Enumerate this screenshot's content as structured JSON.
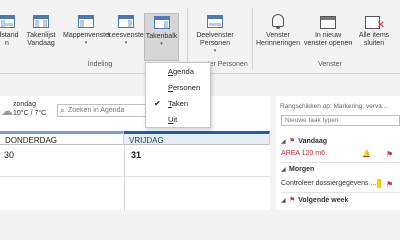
{
  "ribbon": {
    "buttons": {
      "mapvenster": {
        "line1": "Mappenvenster",
        "icon": "folder-pane-icon"
      },
      "leesvenster": {
        "line1": "Leesvenster",
        "icon": "reading-pane-icon"
      },
      "takenbalk": {
        "line1": "Takenbalk",
        "icon": "todo-bar-icon"
      },
      "deelvenster": {
        "line1": "Deelvenster",
        "line2": "Personen",
        "icon": "people-pane-icon"
      },
      "herinneringen": {
        "line1": "Venster",
        "line2": "Herinneringen",
        "icon": "bell-icon"
      },
      "nieuw_venster": {
        "line1": "In nieuw",
        "line2": "venster openen",
        "icon": "new-window-icon"
      },
      "alle_sluiten": {
        "line1": "Alle items",
        "line2": "sluiten",
        "icon": "close-all-icon"
      },
      "takenlijst": {
        "line1": "Takenlijst",
        "line2": "Vandaag",
        "icon": "tasklist-icon"
      },
      "afstand": {
        "line1": "afstand",
        "line2": "n",
        "icon": "spacing-icon"
      }
    },
    "group_labels": {
      "indeling": "Indeling",
      "personen": "nster Personen",
      "venster": "Venster"
    }
  },
  "dropdown": {
    "items": [
      {
        "pre": "",
        "ul": "A",
        "post": "genda",
        "checked": false
      },
      {
        "pre": "",
        "ul": "P",
        "post": "ersonen",
        "checked": false
      },
      {
        "pre": "",
        "ul": "T",
        "post": "aken",
        "checked": true
      },
      {
        "pre": "",
        "ul": "U",
        "post": "it",
        "checked": false
      }
    ]
  },
  "calendar": {
    "weather": {
      "day": "zondag",
      "temp": "10°C / 7°C"
    },
    "search_placeholder": "Zoeken in Agenda",
    "columns": [
      {
        "label": "DONDERDAG",
        "date": "30"
      },
      {
        "label": "VRIJDAG",
        "date": "31"
      }
    ]
  },
  "taskpane": {
    "sort_label": "Rangschikken op: Markering: verva...",
    "new_placeholder": "Nieuwe taak typen",
    "groups": {
      "vandaag": "Vandaag",
      "morgen": "Morgen",
      "volgende_week": "Volgende week"
    },
    "rows": {
      "area": "AREA 120 m6",
      "controleer": "Controleer dossiergegevens ..."
    }
  },
  "colors": {
    "accent": "#1f5cb5",
    "flag_red": "#d13438",
    "today_header": "#e5eef9"
  }
}
